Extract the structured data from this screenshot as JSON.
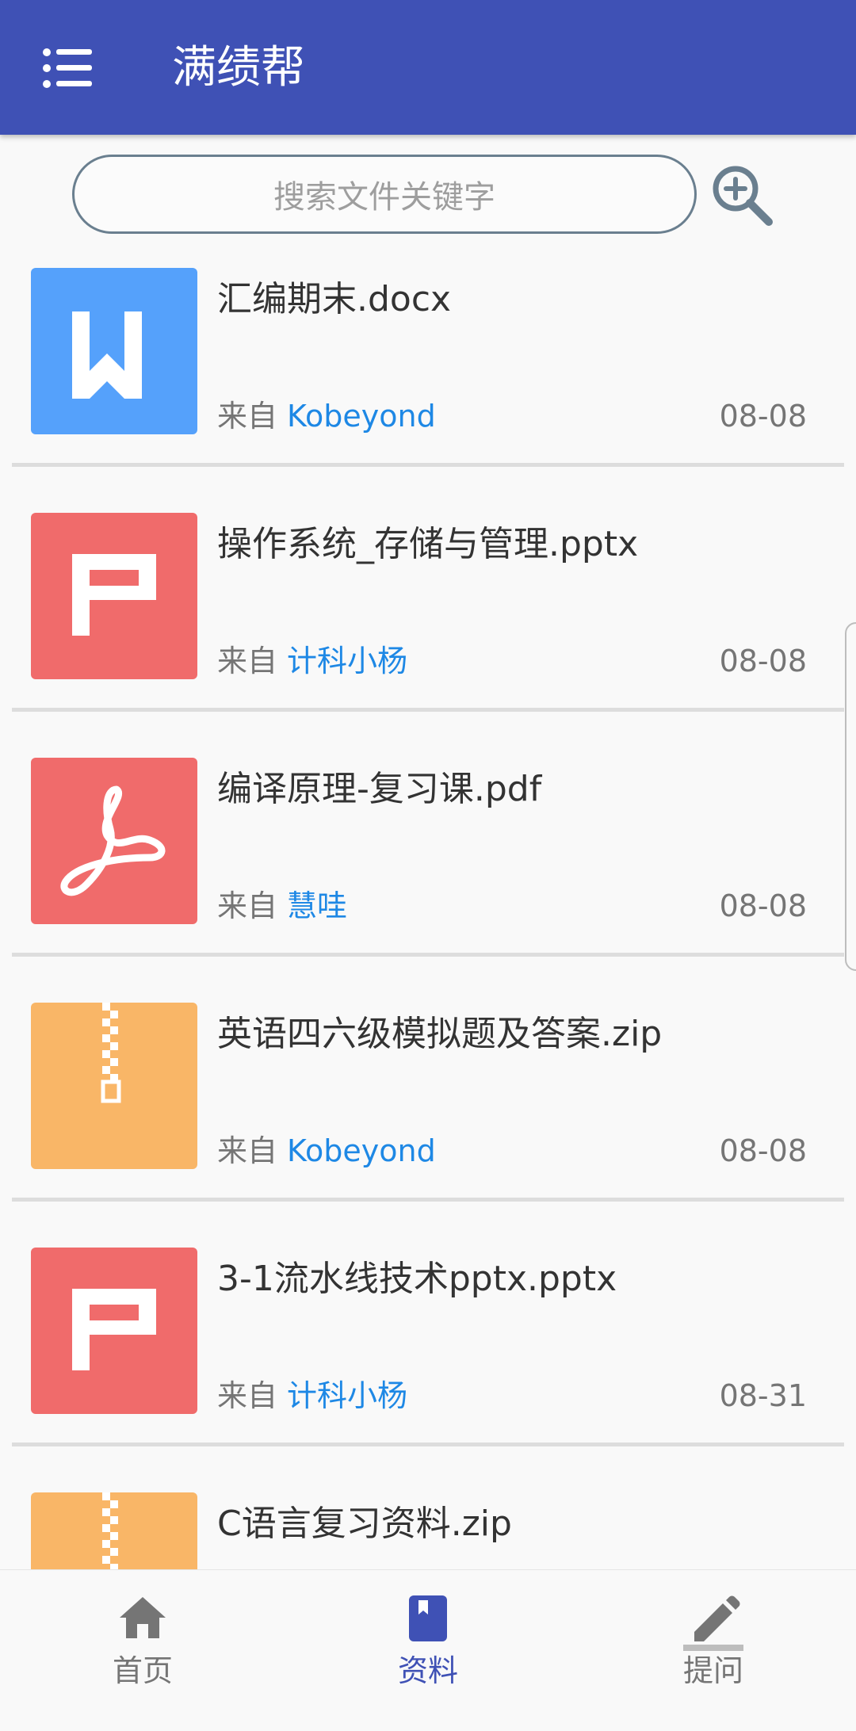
{
  "app": {
    "title": "满绩帮"
  },
  "search": {
    "placeholder": "搜索文件关键字"
  },
  "files": [
    {
      "name": "汇编期末.docx",
      "from_label": "来自",
      "uploader": "Kobeyond",
      "date": "08-08",
      "type": "word"
    },
    {
      "name": "操作系统_存储与管理.pptx",
      "from_label": "来自",
      "uploader": "计科小杨",
      "date": "08-08",
      "type": "ppt"
    },
    {
      "name": "编译原理-复习课.pdf",
      "from_label": "来自",
      "uploader": "慧哇",
      "date": "08-08",
      "type": "pdf"
    },
    {
      "name": "英语四六级模拟题及答案.zip",
      "from_label": "来自",
      "uploader": "Kobeyond",
      "date": "08-08",
      "type": "zip"
    },
    {
      "name": "3-1流水线技术pptx.pptx",
      "from_label": "来自",
      "uploader": "计科小杨",
      "date": "08-31",
      "type": "ppt"
    },
    {
      "name": "C语言复习资料.zip",
      "from_label": "",
      "uploader": "",
      "date": "",
      "type": "zip"
    }
  ],
  "nav": {
    "home": {
      "label": "首页",
      "icon": "home-icon"
    },
    "materials": {
      "label": "资料",
      "icon": "book-icon",
      "active": true
    },
    "ask": {
      "label": "提问",
      "icon": "pencil-icon"
    }
  },
  "colors": {
    "primary": "#3f51b5",
    "word": "#55a1fb",
    "ppt": "#f06b6b",
    "pdf": "#f06b6b",
    "zip": "#f9b667",
    "uploader": "#1e88e5",
    "nav_active": "#3f51b5",
    "nav_inactive": "#757575"
  }
}
